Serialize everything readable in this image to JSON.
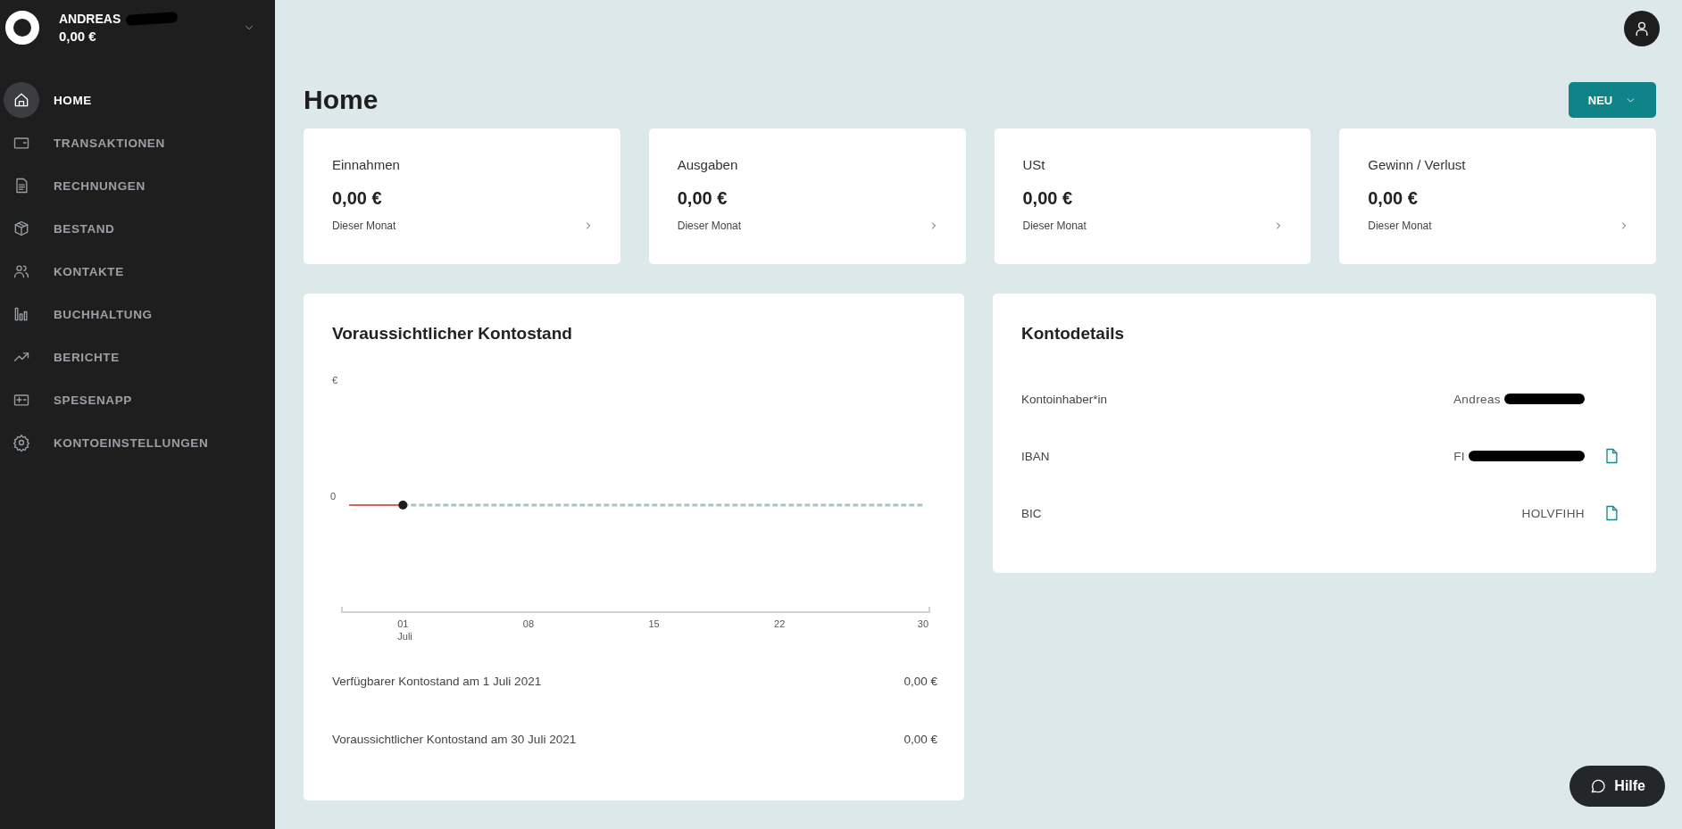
{
  "account": {
    "name": "ANDREAS",
    "balance": "0,00 €"
  },
  "nav": [
    {
      "label": "HOME",
      "selected": true
    },
    {
      "label": "TRANSAKTIONEN",
      "selected": false
    },
    {
      "label": "RECHNUNGEN",
      "selected": false
    },
    {
      "label": "BESTAND",
      "selected": false
    },
    {
      "label": "KONTAKTE",
      "selected": false
    },
    {
      "label": "BUCHHALTUNG",
      "selected": false
    },
    {
      "label": "BERICHTE",
      "selected": false
    },
    {
      "label": "SPESENAPP",
      "selected": false
    },
    {
      "label": "KONTOEINSTELLUNGEN",
      "selected": false
    }
  ],
  "page_title": "Home",
  "new_button": "NEU",
  "stats": [
    {
      "label": "Einnahmen",
      "value": "0,00 €",
      "period": "Dieser Monat"
    },
    {
      "label": "Ausgaben",
      "value": "0,00 €",
      "period": "Dieser Monat"
    },
    {
      "label": "USt",
      "value": "0,00 €",
      "period": "Dieser Monat"
    },
    {
      "label": "Gewinn / Verlust",
      "value": "0,00 €",
      "period": "Dieser Monat"
    }
  ],
  "forecast": {
    "title": "Voraussichtlicher Kontostand",
    "chart": {
      "unit": "€",
      "zero_label": "0",
      "x_labels": [
        "01",
        "08",
        "15",
        "22",
        "30"
      ],
      "month": "Juli"
    },
    "rows": [
      {
        "label": "Verfügbarer Kontostand am 1 Juli 2021",
        "value": "0,00 €"
      },
      {
        "label": "Voraussichtlicher Kontostand am 30 Juli 2021",
        "value": "0,00 €"
      }
    ]
  },
  "details": {
    "title": "Kontodetails",
    "rows": [
      {
        "label": "Kontoinhaber*in",
        "value": "Andreas",
        "copy": false
      },
      {
        "label": "IBAN",
        "value": "FI",
        "copy": true
      },
      {
        "label": "BIC",
        "value": "HOLVFIHH",
        "copy": true
      }
    ]
  },
  "help_button": "Hilfe"
}
